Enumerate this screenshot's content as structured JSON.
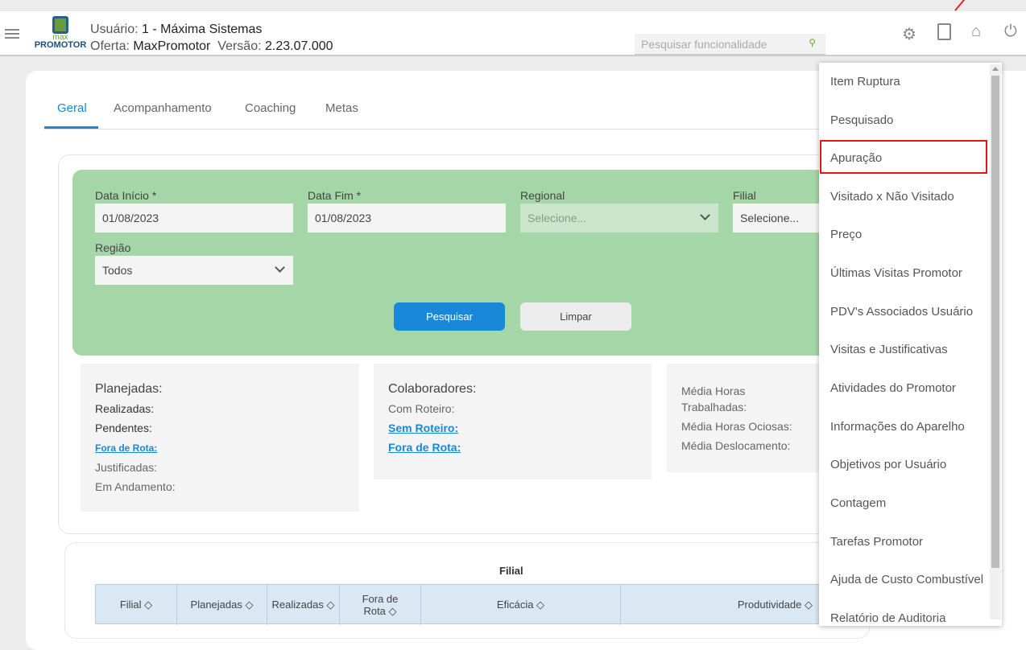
{
  "header": {
    "user_label": "Usuário:",
    "user_value": "1 - Máxima Sistemas",
    "offer_label": "Oferta:",
    "offer_value": "MaxPromotor",
    "version_label": "Versão:",
    "version_value": "2.23.07.000",
    "logo_top": "max",
    "logo_bottom": "PROMOTOR",
    "search_placeholder": "Pesquisar funcionalidade"
  },
  "tabs": [
    "Geral",
    "Acompanhamento",
    "Coaching",
    "Metas"
  ],
  "filters": {
    "data_inicio_label": "Data Início *",
    "data_inicio": "01/08/2023",
    "data_fim_label": "Data Fim *",
    "data_fim": "01/08/2023",
    "regional_label": "Regional",
    "regional_value": "Selecione...",
    "filial_label": "Filial",
    "filial_value": "Selecione...",
    "regiao_label": "Região",
    "regiao_value": "Todos",
    "search_button": "Pesquisar",
    "clear_button": "Limpar"
  },
  "stats": {
    "planejadas": "Planejadas:",
    "realizadas": "Realizadas:",
    "pendentes": "Pendentes:",
    "fora_rota": "Fora de Rota:",
    "justificadas": "Justificadas:",
    "em_andamento": "Em Andamento:",
    "colaboradores": "Colaboradores:",
    "com_roteiro": "Com Roteiro:",
    "sem_roteiro": "Sem Roteiro:",
    "fora_rota2": "Fora de Rota:",
    "media_horas": "Média Horas Trabalhadas:",
    "media_ociosas": "Média Horas Ociosas:",
    "media_desloc": "Média Deslocamento:"
  },
  "table": {
    "title": "Filial",
    "columns": [
      "Filial ◇",
      "Planejadas ◇",
      "Realizadas ◇",
      "Fora de Rota ◇",
      "Eficácia ◇",
      "Produtividade ◇"
    ]
  },
  "dropdown": {
    "items": [
      "Item Ruptura",
      "Pesquisado",
      "Apuração",
      "Visitado x Não Visitado",
      "Preço",
      "Últimas Visitas Promotor",
      "PDV's Associados Usuário",
      "Visitas e Justificativas",
      "Atividades do Promotor",
      "Informações do Aparelho",
      "Objetivos por Usuário",
      "Contagem",
      "Tarefas Promotor",
      "Ajuda de Custo Combustível",
      "Relatório de Auditoria"
    ],
    "highlighted": "Apuração"
  }
}
